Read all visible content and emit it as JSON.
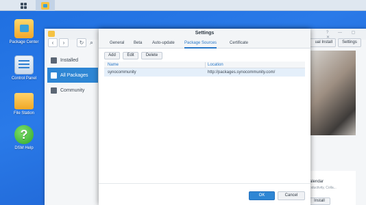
{
  "desktop": {
    "icons": [
      {
        "label": "Package Center",
        "icon": "package-center-icon"
      },
      {
        "label": "Control Panel",
        "icon": "control-panel-icon"
      },
      {
        "label": "File Station",
        "icon": "folder-icon"
      },
      {
        "label": "DSM Help",
        "icon": "help-icon",
        "glyph": "?"
      }
    ]
  },
  "package_center": {
    "sidebar": [
      {
        "label": "Installed",
        "icon": "download-icon"
      },
      {
        "label": "All Packages",
        "icon": "grid-icon",
        "selected": true
      },
      {
        "label": "Community",
        "icon": "community-icon"
      }
    ],
    "toolbar": {
      "back": "‹",
      "forward": "›",
      "refresh": "↻",
      "search": "⌕"
    },
    "window_controls": "? — ▢ ✕",
    "manual_install_label": "ual Install",
    "settings_label": "Settings",
    "promo": {
      "name": "alendar",
      "subtitle": "oductivity, Colla...",
      "install_label": "Install"
    }
  },
  "settings_dialog": {
    "title": "Settings",
    "tabs": [
      {
        "label": "General"
      },
      {
        "label": "Beta"
      },
      {
        "label": "Auto-update"
      },
      {
        "label": "Package Sources",
        "active": true
      },
      {
        "label": "Certificate"
      }
    ],
    "buttons": {
      "add": "Add",
      "edit": "Edit",
      "delete": "Delete"
    },
    "table": {
      "columns": [
        "Name",
        "Location"
      ],
      "rows": [
        {
          "name": "synocommunity",
          "location": "http://packages.synocommunity.com/"
        }
      ]
    },
    "ok_label": "OK",
    "cancel_label": "Cancel"
  },
  "colors": {
    "accent": "#2e86d4",
    "desktop": "#2a7ae8"
  }
}
